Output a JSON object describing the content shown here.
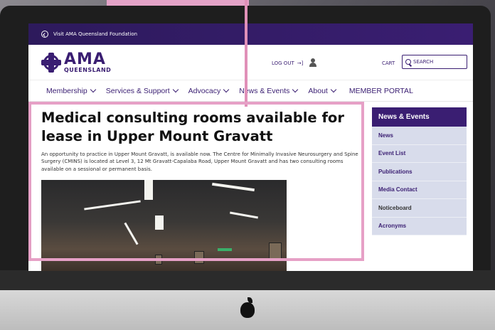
{
  "topbar": {
    "label": "Visit AMA Queensland Foundation"
  },
  "logo": {
    "big": "AMA",
    "small": "QUEENSLAND"
  },
  "header": {
    "logout": "LOG OUT",
    "cart": "CART",
    "search_placeholder": "SEARCH"
  },
  "nav": {
    "items": [
      "Membership",
      "Services & Support",
      "Advocacy",
      "News & Events",
      "About"
    ],
    "portal": "MEMBER PORTAL"
  },
  "article": {
    "title": "Medical consulting rooms available for lease in Upper Mount Gravatt",
    "intro": "An opportunity to practice in Upper Mount Gravatt, is available now. The Centre for Minimally Invasive Neurosurgery and Spine Surgery (CMINS) is located at Level 3, 12 Mt Gravatt-Capalaba Road, Upper Mount Gravatt and has two consulting rooms available on a sessional or permanent basis."
  },
  "sidebar": {
    "heading": "News & Events",
    "links": [
      "News",
      "Event List",
      "Publications",
      "Media Contact",
      "Noticeboard",
      "Acronyms"
    ]
  },
  "colors": {
    "brand": "#3a1e72",
    "highlight": "#e6a0c6",
    "sidebar_bg": "#d8dceb"
  }
}
